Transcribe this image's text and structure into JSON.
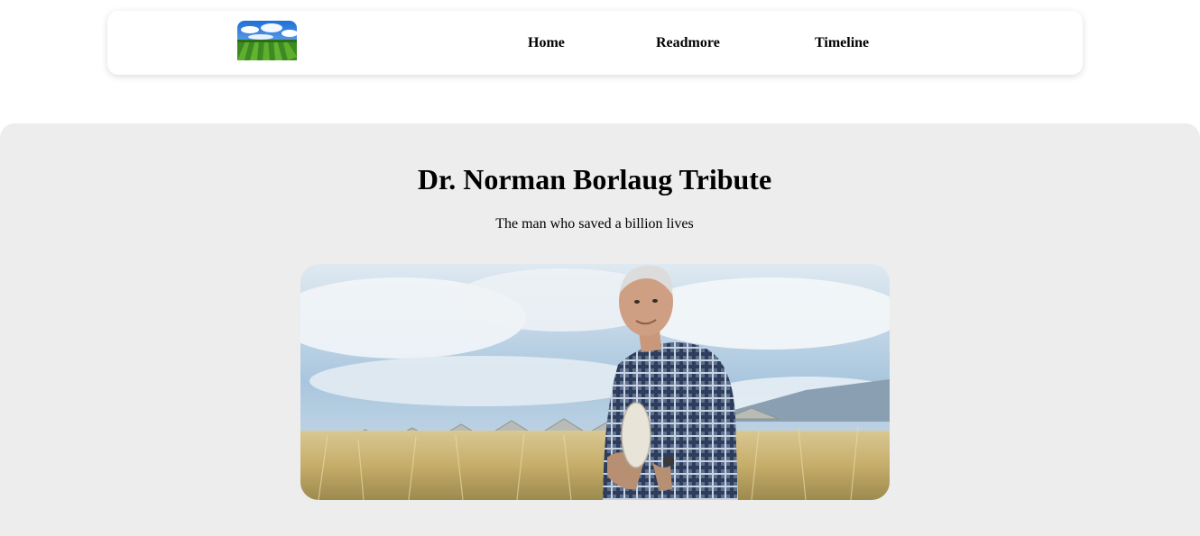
{
  "nav": {
    "logo_icon": "farm-field-logo",
    "links": [
      {
        "label": "Home"
      },
      {
        "label": "Readmore"
      },
      {
        "label": "Timeline"
      }
    ]
  },
  "hero": {
    "title": "Dr. Norman Borlaug Tribute",
    "subtitle": "The man who saved a billion lives",
    "image_icon": "portrait-in-wheat-field-photo"
  },
  "colors": {
    "page_background": "#ffffff",
    "hero_background": "#ededed",
    "text": "#000000"
  }
}
